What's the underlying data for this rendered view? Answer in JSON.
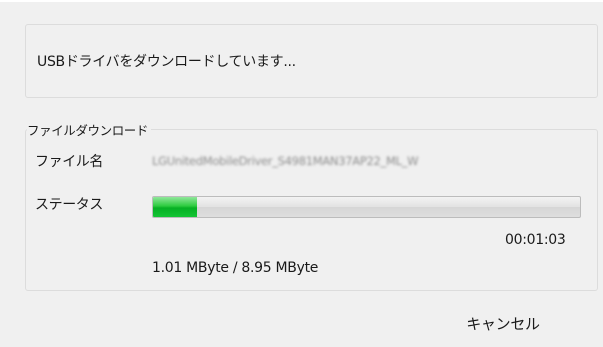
{
  "message": {
    "text": "USBドライバをダウンロードしています..."
  },
  "download_group": {
    "title": "ファイルダウンロード",
    "file_name_label": "ファイル名",
    "file_name_value": "LGUnitedMobileDriver_S4981MAN37AP22_ML_W",
    "status_label": "ステータス",
    "progress_fraction": 0.103,
    "elapsed_time": "00:01:03",
    "transfer_size": "1.01 MByte / 8.95 MByte"
  },
  "buttons": {
    "cancel_label": "キャンセル"
  }
}
